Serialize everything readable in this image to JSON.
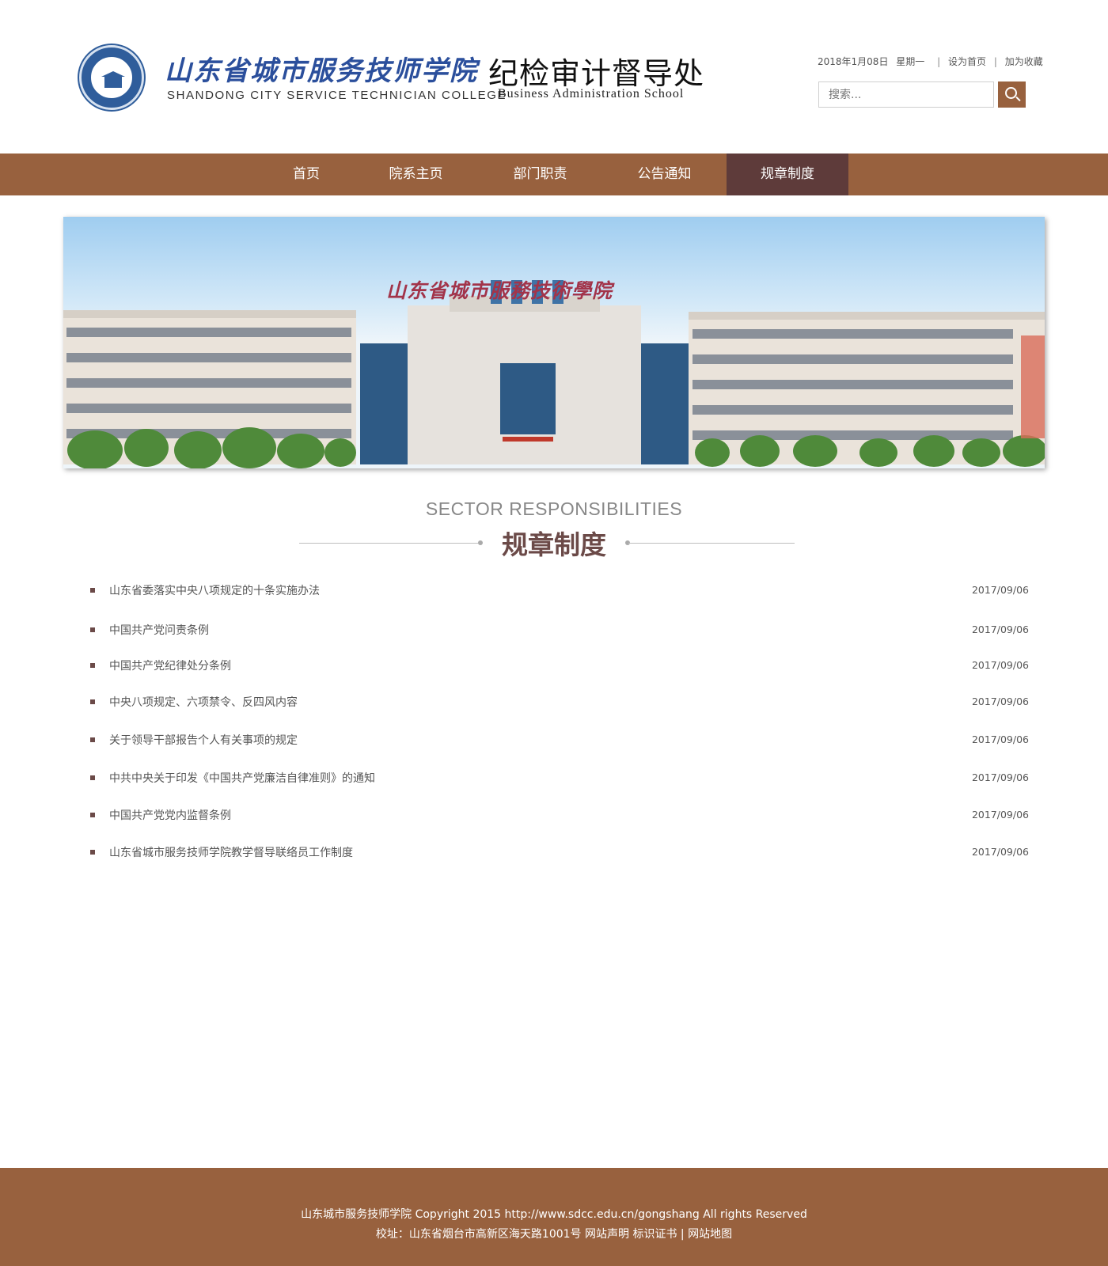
{
  "header": {
    "school_name_cn": "山东省城市服务技师学院",
    "school_name_en": "SHANDONG CITY SERVICE TECHNICIAN COLLEGE",
    "dept_name_cn": "纪检审计督导处",
    "dept_name_en": "Business Administration School",
    "date": "2018年1月08日",
    "weekday": "星期一",
    "set_home": "设为首页",
    "add_fav": "加为收藏",
    "search_placeholder": "搜索..."
  },
  "nav": {
    "items": [
      "首页",
      "院系主页",
      "部门职责",
      "公告通知",
      "规章制度"
    ],
    "active": "规章制度"
  },
  "banner": {
    "sign_text": "山东省城市服務技術學院"
  },
  "section": {
    "title_en": "SECTOR RESPONSIBILITIES",
    "title_cn": "规章制度"
  },
  "articles": [
    {
      "title": "山东省委落实中央八项规定的十条实施办法",
      "date": "2017/09/06"
    },
    {
      "title": "中国共产党问责条例",
      "date": "2017/09/06"
    },
    {
      "title": "中国共产党纪律处分条例",
      "date": "2017/09/06"
    },
    {
      "title": "中央八项规定、六项禁令、反四风内容",
      "date": "2017/09/06"
    },
    {
      "title": "关于领导干部报告个人有关事项的规定",
      "date": "2017/09/06"
    },
    {
      "title": "中共中央关于印发《中国共产党廉洁自律准则》的通知",
      "date": "2017/09/06"
    },
    {
      "title": "中国共产党党内监督条例",
      "date": "2017/09/06"
    },
    {
      "title": "山东省城市服务技师学院教学督导联络员工作制度",
      "date": "2017/09/06"
    }
  ],
  "footer": {
    "line1": "山东城市服务技师学院 Copyright 2015 http://www.sdcc.edu.cn/gongshang All rights Reserved",
    "address": "校址：山东省烟台市高新区海天路1001号",
    "statement": "网站声明",
    "certificate": "标识证书",
    "sep": "|",
    "sitemap": "网站地图"
  },
  "colors": {
    "brand_brown": "#98613e",
    "active_nav": "#5e3b3a",
    "heading_cn": "#6b4a48",
    "logo_blue": "#2b4f9c"
  }
}
